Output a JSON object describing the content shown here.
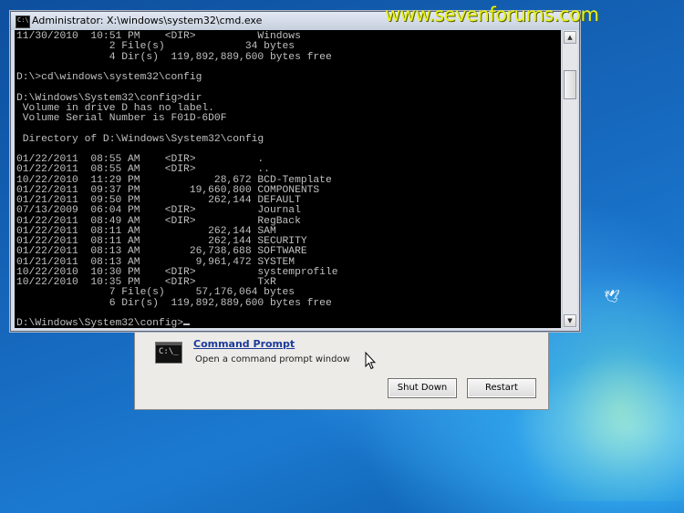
{
  "cmd_window": {
    "title": "Administrator: X:\\windows\\system32\\cmd.exe",
    "icon_label": "C:\\",
    "console_text": "11/30/2010  10:51 PM    <DIR>          Windows\n               2 File(s)             34 bytes\n               4 Dir(s)  119,892,889,600 bytes free\n\nD:\\>cd\\windows\\system32\\config\n\nD:\\Windows\\System32\\config>dir\n Volume in drive D has no label.\n Volume Serial Number is F01D-6D0F\n\n Directory of D:\\Windows\\System32\\config\n\n01/22/2011  08:55 AM    <DIR>          .\n01/22/2011  08:55 AM    <DIR>          ..\n10/22/2010  11:29 PM            28,672 BCD-Template\n01/22/2011  09:37 PM        19,660,800 COMPONENTS\n01/21/2011  09:50 PM           262,144 DEFAULT\n07/13/2009  06:04 PM    <DIR>          Journal\n01/22/2011  08:49 AM    <DIR>          RegBack\n01/22/2011  08:11 AM           262,144 SAM\n01/22/2011  08:11 AM           262,144 SECURITY\n01/22/2011  08:13 AM        26,738,688 SOFTWARE\n01/21/2011  08:13 AM         9,961,472 SYSTEM\n10/22/2010  10:30 PM    <DIR>          systemprofile\n10/22/2010  10:35 PM    <DIR>          TxR\n               7 File(s)     57,176,064 bytes\n               6 Dir(s)  119,892,889,600 bytes free\n\nD:\\Windows\\System32\\config>"
  },
  "watermark": "www.sevenforums.com",
  "recovery_panel": {
    "icon_label": "C:\\_",
    "tool_link": "Command Prompt",
    "tool_description": "Open a command prompt window",
    "shutdown_label": "Shut Down",
    "restart_label": "Restart"
  },
  "colors": {
    "watermark": "#e8f21a",
    "console_bg": "#000000",
    "console_text": "#c0c0c0",
    "link": "#1c3a9a"
  },
  "icons": {
    "scroll_up": "up-arrow-icon",
    "scroll_down": "down-arrow-icon",
    "pointer": "mouse-pointer-icon"
  }
}
